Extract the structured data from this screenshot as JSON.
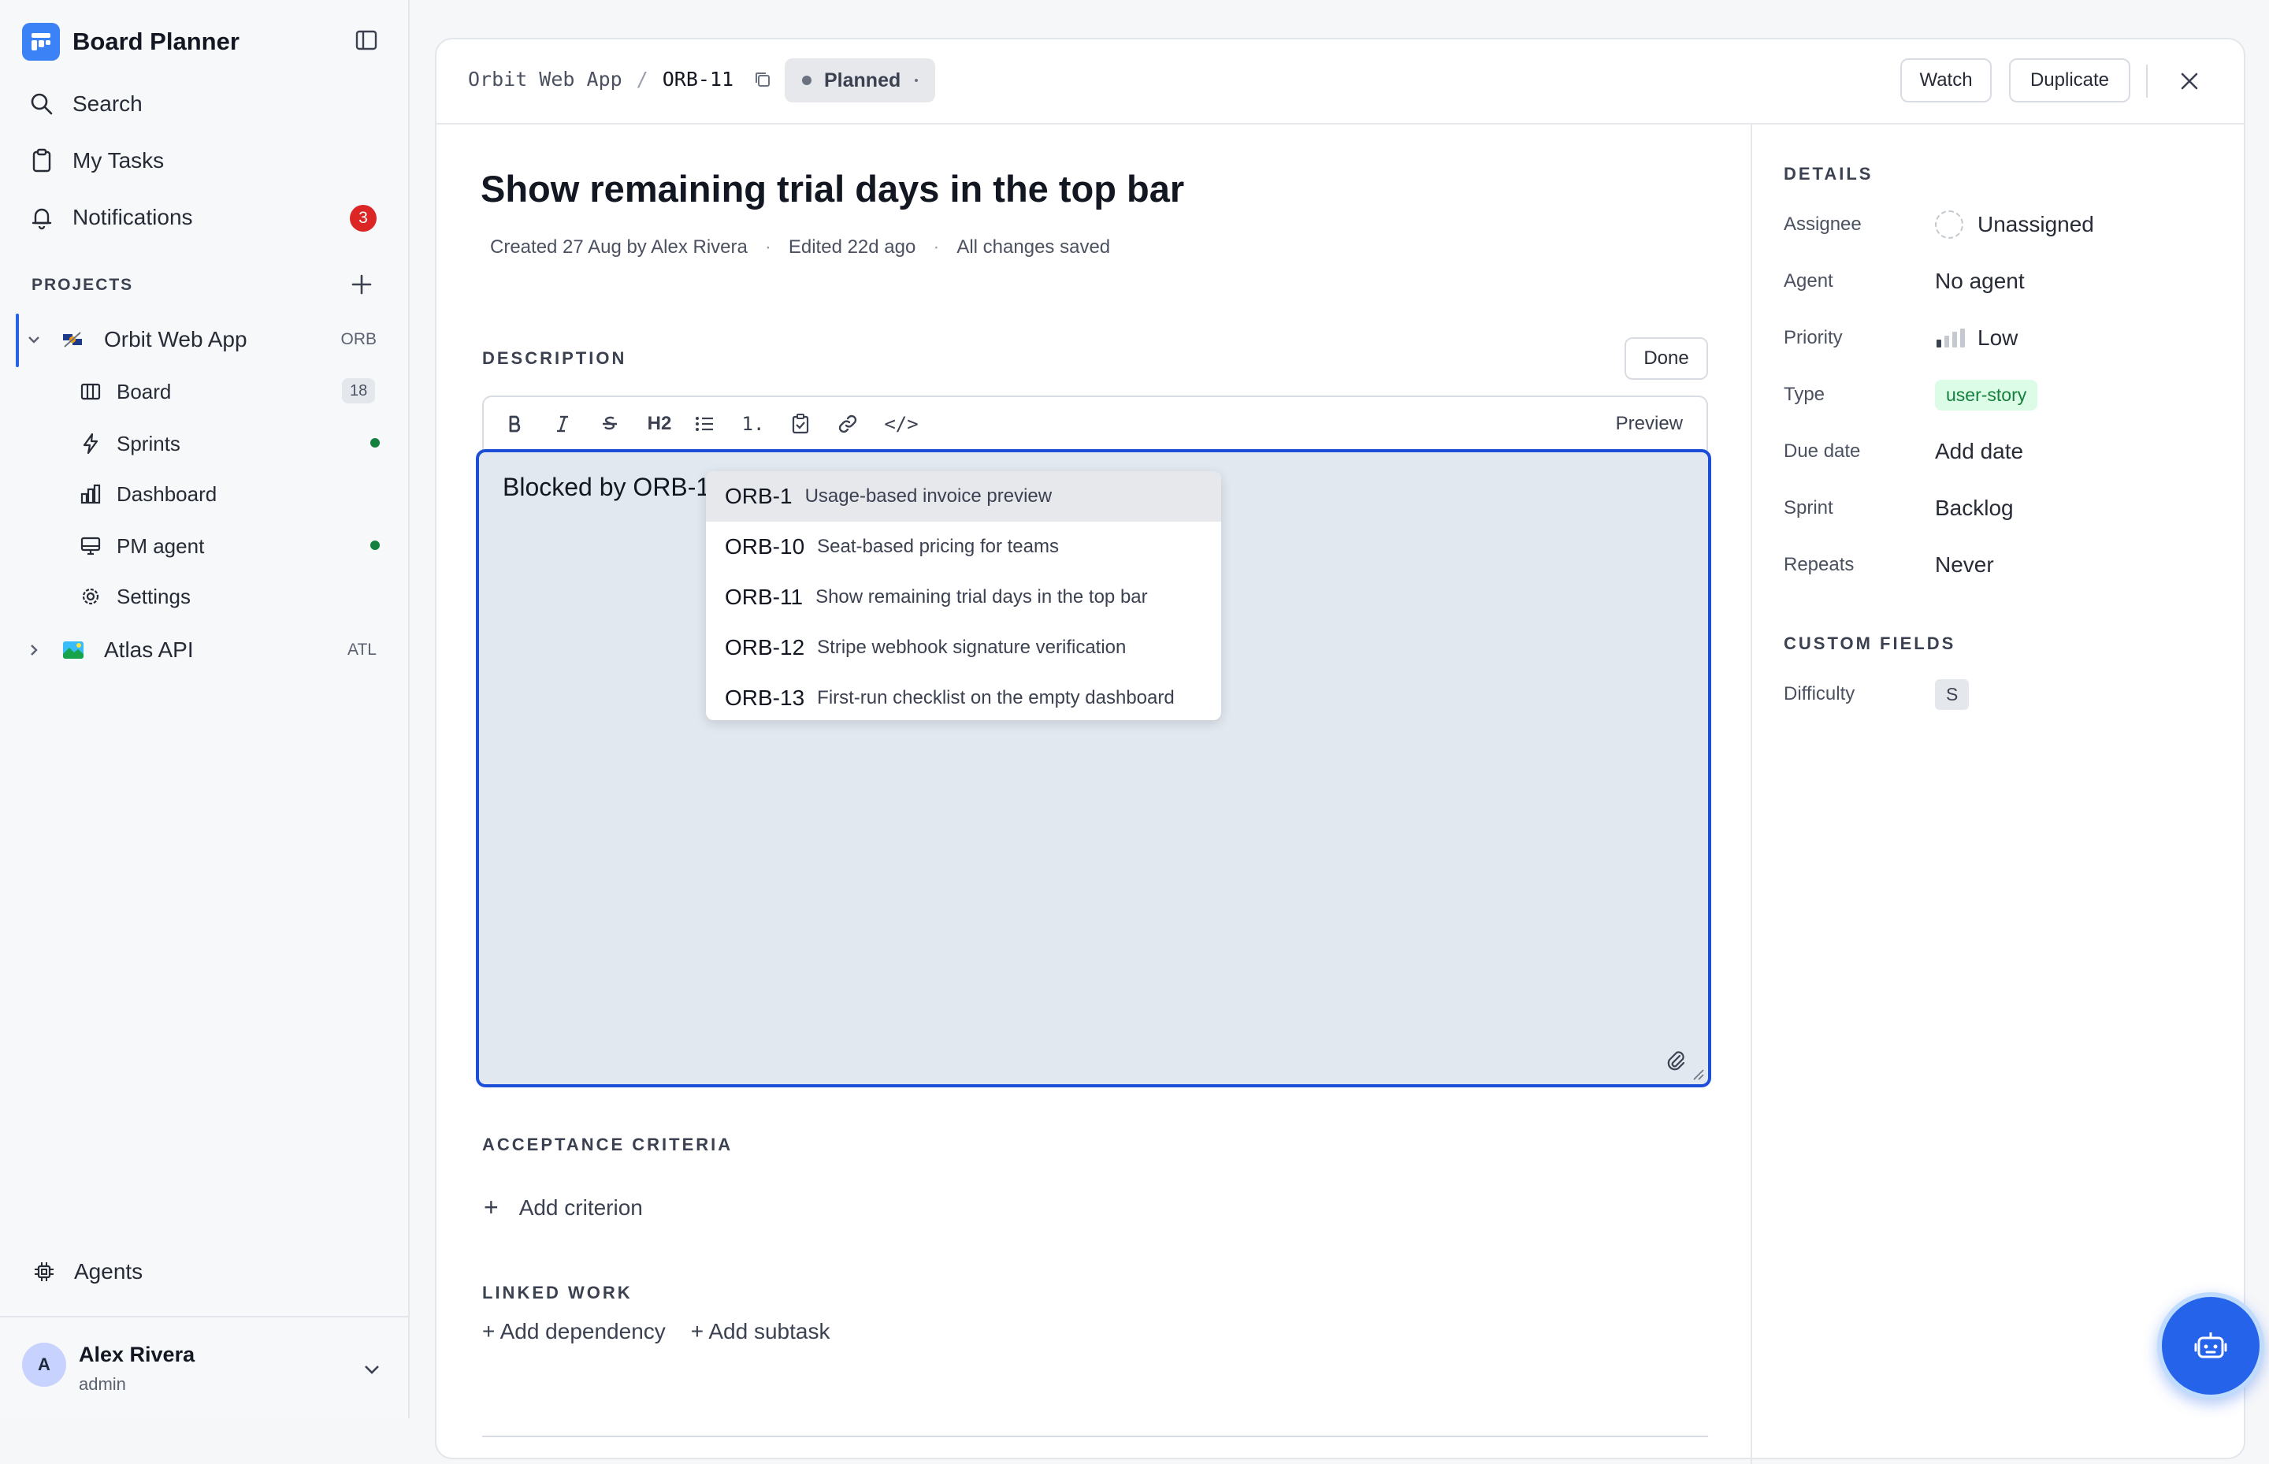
{
  "app": {
    "title": "Board Planner"
  },
  "nav": {
    "search": "Search",
    "my_tasks": "My Tasks",
    "notifications": "Notifications",
    "notifications_count": "3"
  },
  "projects": {
    "section_title": "PROJECTS",
    "items": [
      {
        "name": "Orbit Web App",
        "key": "ORB",
        "subitems": [
          {
            "label": "Board",
            "count": "18"
          },
          {
            "label": "Sprints"
          },
          {
            "label": "Dashboard"
          },
          {
            "label": "PM agent"
          },
          {
            "label": "Settings"
          }
        ]
      },
      {
        "name": "Atlas API",
        "key": "ATL"
      }
    ]
  },
  "agents_label": "Agents",
  "user": {
    "initial": "A",
    "name": "Alex Rivera",
    "role": "admin"
  },
  "issue": {
    "breadcrumb_project": "Orbit Web App",
    "breadcrumb_sep": "/",
    "id": "ORB-11",
    "status": "Planned",
    "watch_label": "Watch",
    "duplicate_label": "Duplicate",
    "title": "Show remaining trial days in the top bar",
    "meta_created": "Created 27 Aug by Alex Rivera",
    "meta_edited": "Edited 22d ago",
    "meta_saved": "All changes saved",
    "meta_sep": "·"
  },
  "description": {
    "label": "DESCRIPTION",
    "done_label": "Done",
    "toolbar": {
      "h2": "H2",
      "ordered": "1.",
      "code": "</>",
      "preview": "Preview"
    },
    "text": "Blocked by ORB-1",
    "suggestions": [
      {
        "key": "ORB-1",
        "title": "Usage-based invoice preview"
      },
      {
        "key": "ORB-10",
        "title": "Seat-based pricing for teams"
      },
      {
        "key": "ORB-11",
        "title": "Show remaining trial days in the top bar"
      },
      {
        "key": "ORB-12",
        "title": "Stripe webhook signature verification"
      },
      {
        "key": "ORB-13",
        "title": "First-run checklist on the empty dashboard"
      }
    ]
  },
  "acceptance": {
    "label": "ACCEPTANCE CRITERIA",
    "add_label": "Add criterion",
    "plus": "+"
  },
  "linked": {
    "label": "LINKED WORK",
    "add_dependency": "+ Add dependency",
    "add_subtask": "+ Add subtask"
  },
  "details": {
    "label": "DETAILS",
    "rows": [
      {
        "label": "Assignee",
        "value": "Unassigned"
      },
      {
        "label": "Agent",
        "value": "No agent"
      },
      {
        "label": "Priority",
        "value": "Low"
      },
      {
        "label": "Type",
        "value": "user-story"
      },
      {
        "label": "Due date",
        "value": "Add date"
      },
      {
        "label": "Sprint",
        "value": "Backlog"
      },
      {
        "label": "Repeats",
        "value": "Never"
      }
    ],
    "custom_label": "CUSTOM FIELDS",
    "custom_rows": [
      {
        "label": "Difficulty",
        "value": "S"
      }
    ]
  },
  "colors": {
    "accent": "#2563eb",
    "badge": "#dc2626",
    "online": "#15803d",
    "type_tag": "#15803d"
  }
}
